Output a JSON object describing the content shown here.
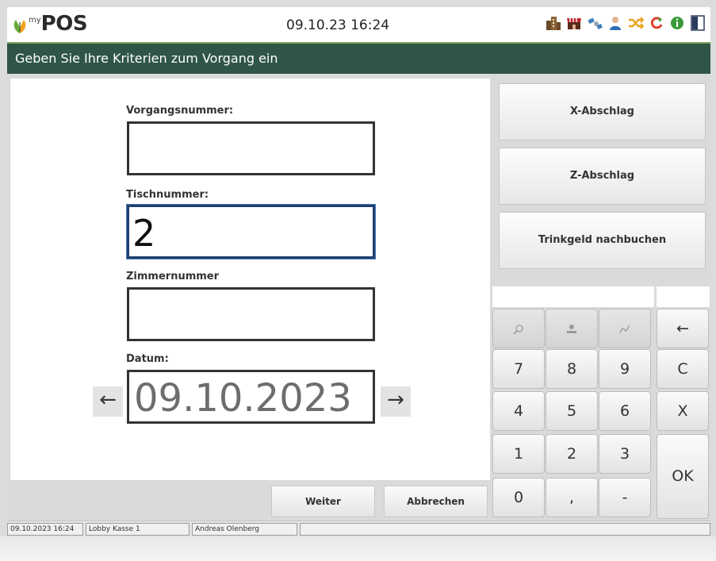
{
  "header": {
    "logo_my": "my",
    "logo_pos": "POS",
    "datetime": "09.10.23  16:24",
    "icons": [
      "building-icon",
      "shop-icon",
      "satellite-icon",
      "user-icon",
      "shuffle-icon",
      "refresh-icon",
      "info-icon",
      "panel-icon"
    ]
  },
  "title": "Geben Sie Ihre Kriterien zum Vorgang ein",
  "form": {
    "vorgang_label": "Vorgangsnummer:",
    "vorgang_value": "",
    "tisch_label": "Tischnummer:",
    "tisch_value": "2",
    "zimmer_label": "Zimmernummer",
    "zimmer_value": "",
    "datum_label": "Datum:",
    "datum_value": "09.10.2023",
    "prev_arrow": "←",
    "next_arrow": "→"
  },
  "buttons": {
    "weiter": "Weiter",
    "abbrechen": "Abbrechen",
    "x_abschlag": "X-Abschlag",
    "z_abschlag": "Z-Abschlag",
    "trinkgeld": "Trinkgeld nachbuchen"
  },
  "keypad": {
    "backspace": "←",
    "k7": "7",
    "k8": "8",
    "k9": "9",
    "clear": "C",
    "k4": "4",
    "k5": "5",
    "k6": "6",
    "cancel": "X",
    "k1": "1",
    "k2": "2",
    "k3": "3",
    "ok": "OK",
    "k0": "0",
    "comma": ",",
    "minus": "-"
  },
  "status": {
    "datetime": "09.10.2023 16:24",
    "location": "Lobby Kasse 1",
    "user": "Andreas Olenberg",
    "extra": ""
  },
  "colors": {
    "titlebar": "#2f5546",
    "header_rule": "#7fa15a"
  }
}
